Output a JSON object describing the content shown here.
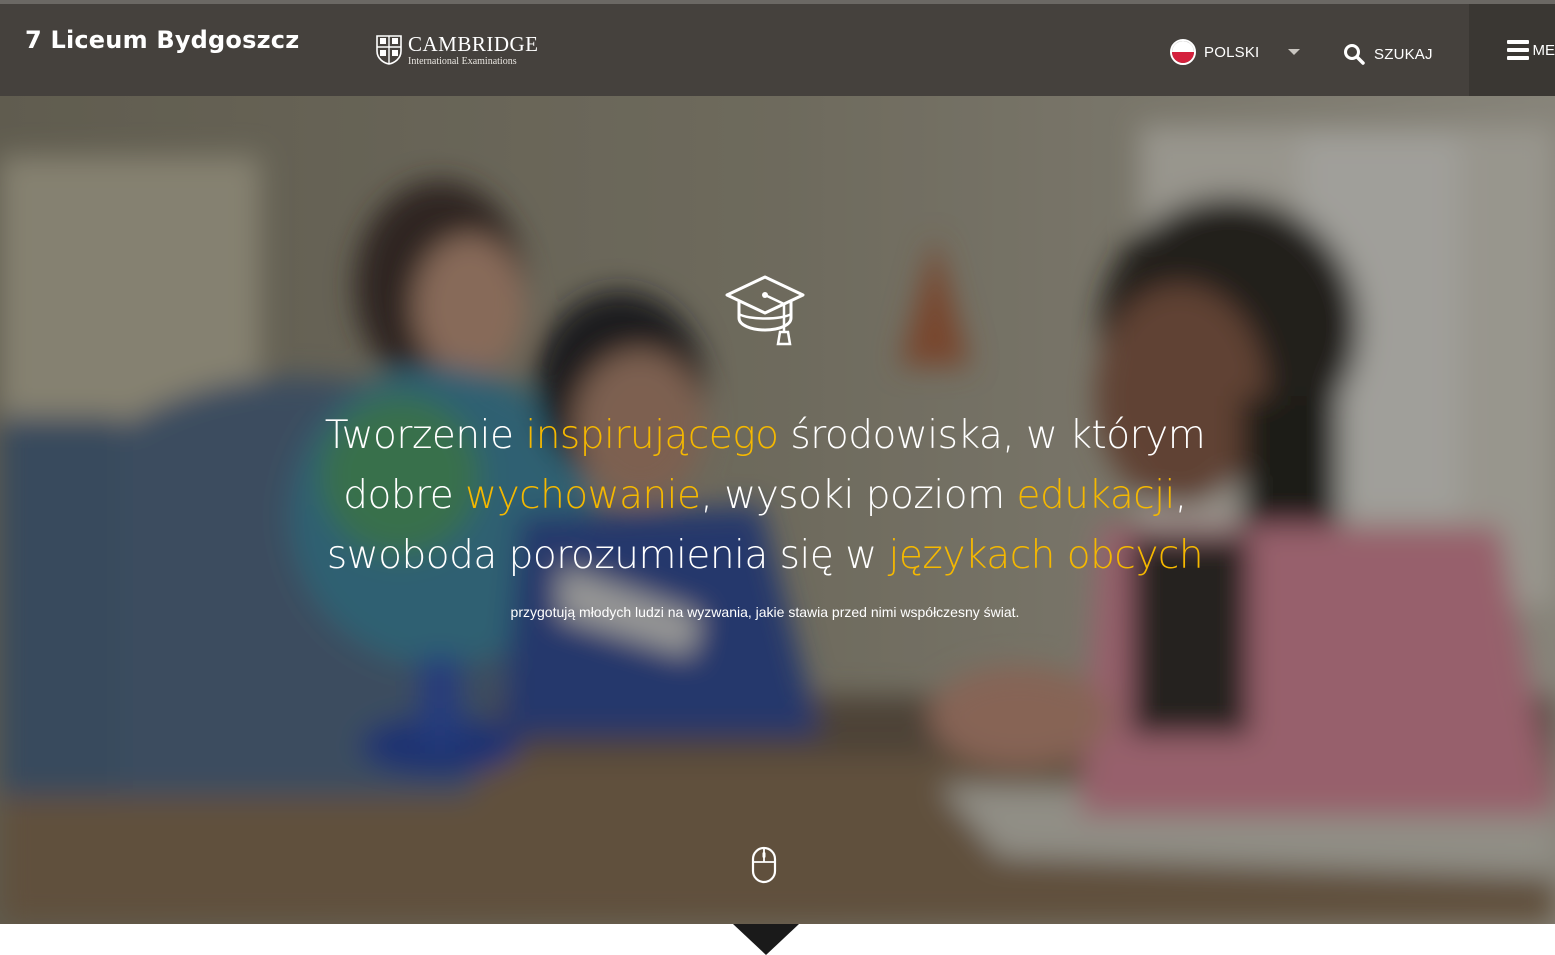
{
  "header": {
    "site_title": "7 Liceum Bydgoszcz",
    "logo": {
      "name": "CAMBRIDGE",
      "subtitle": "International Examinations",
      "icon": "cambridge-shield-icon"
    },
    "language": {
      "label": "POLSKI",
      "flag": "poland-flag-icon",
      "caret": "caret-down-icon"
    },
    "search": {
      "label": "SZUKAJ",
      "icon": "search-icon"
    },
    "menu": {
      "label": "ME",
      "icon": "hamburger-menu-icon"
    }
  },
  "hero": {
    "icon": "graduation-cap-icon",
    "headline": {
      "line1": [
        "Tworzenie ",
        "inspirującego",
        " środowiska, w którym"
      ],
      "line2": [
        "dobre ",
        "wychowanie",
        ", wysoki poziom ",
        "edukacji",
        ","
      ],
      "line3": [
        "swoboda porozumienia się w ",
        "językach obcych"
      ]
    },
    "subline": "przygotują młodych ludzi na wyzwania, jakie stawia przed nimi współczesny świat.",
    "scroll_icon": "mouse-scroll-icon",
    "highlight_color": "#f5b800"
  },
  "colors": {
    "header_bg": "#45413d",
    "menu_bg": "#3a3733",
    "accent": "#f5b800"
  },
  "footer": {
    "arrow_icon": "arrow-down-icon"
  }
}
